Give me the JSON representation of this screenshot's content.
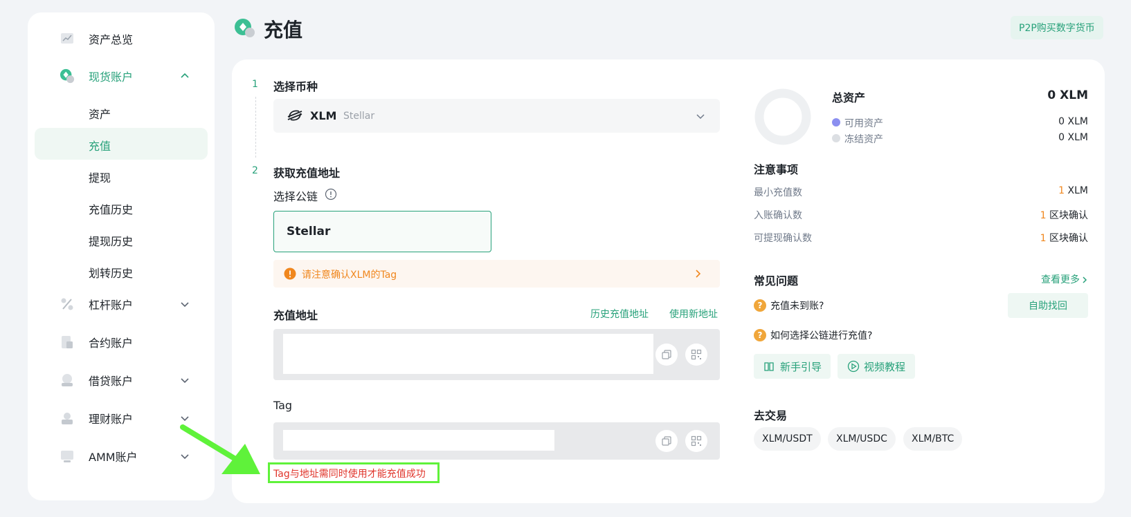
{
  "sidebar": {
    "items": [
      {
        "label": "资产总览",
        "icon": "chart-icon"
      },
      {
        "label": "现货账户",
        "icon": "spot-icon"
      },
      {
        "label": "杠杆账户",
        "icon": "margin-icon"
      },
      {
        "label": "合约账户",
        "icon": "contract-icon"
      },
      {
        "label": "借贷账户",
        "icon": "loan-icon"
      },
      {
        "label": "理财账户",
        "icon": "finance-icon"
      },
      {
        "label": "AMM账户",
        "icon": "amm-icon"
      }
    ],
    "subitems": [
      "资产",
      "充值",
      "提现",
      "充值历史",
      "提现历史",
      "划转历史"
    ]
  },
  "header": {
    "title": "充值",
    "p2p_button": "P2P购买数字货币"
  },
  "steps": {
    "step1_num": "1",
    "step1_title": "选择币种",
    "step2_num": "2",
    "step2_title": "获取充值地址"
  },
  "coin": {
    "symbol": "XLM",
    "name": "Stellar"
  },
  "chain": {
    "label": "选择公链",
    "selected": "Stellar"
  },
  "warning": {
    "text": "请注意确认XLM的Tag"
  },
  "address": {
    "label": "充值地址",
    "history_link": "历史充值地址",
    "new_link": "使用新地址",
    "value": ""
  },
  "tag": {
    "label": "Tag",
    "value": "",
    "note": "Tag与地址需同时使用才能充值成功"
  },
  "assets": {
    "title": "总资产",
    "total": "0 XLM",
    "available_label": "可用资产",
    "available_value": "0 XLM",
    "frozen_label": "冻结资产",
    "frozen_value": "0 XLM"
  },
  "notice": {
    "title": "注意事项",
    "rows": [
      {
        "label": "最小充值数",
        "num": "1",
        "unit": "XLM"
      },
      {
        "label": "入账确认数",
        "num": "1",
        "unit": "区块确认"
      },
      {
        "label": "可提现确认数",
        "num": "1",
        "unit": "区块确认"
      }
    ]
  },
  "faq": {
    "title": "常见问题",
    "more": "查看更多",
    "q1": "充值未到账?",
    "q1_button": "自助找回",
    "q2": "如何选择公链进行充值?",
    "guide_button": "新手引导",
    "video_button": "视频教程"
  },
  "trade": {
    "title": "去交易",
    "pairs": [
      "XLM/USDT",
      "XLM/USDC",
      "XLM/BTC"
    ]
  },
  "colors": {
    "accent": "#27a17a",
    "warning": "#f0871e",
    "annotation": "#5ff23a",
    "error": "#e0352b"
  }
}
